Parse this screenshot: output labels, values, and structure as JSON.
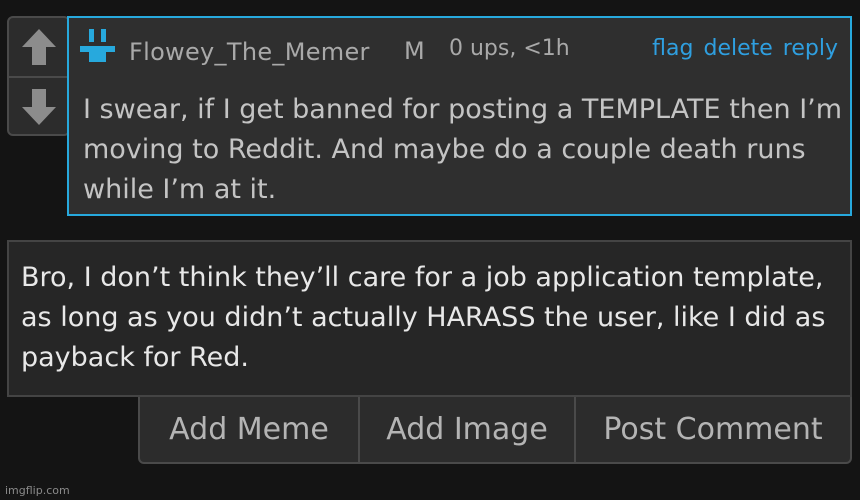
{
  "comment": {
    "username": "Flowey_The_Memer",
    "badge": "M",
    "meta": "0 ups, <1h",
    "actions": {
      "flag": "flag",
      "delete": "delete",
      "reply": "reply"
    },
    "body": "I swear, if I get banned for posting a TEMPLATE then I’m moving to Reddit. And maybe do a couple death runs while I’m at it."
  },
  "reply_box": {
    "text": "Bro, I don’t think they’ll care for a job application template, as long as you didn’t actually HARASS the user, like I did as payback for Red."
  },
  "buttons": {
    "add_meme": "Add Meme",
    "add_image": "Add Image",
    "post_comment": "Post Comment"
  },
  "watermark": "imgflip.com",
  "colors": {
    "accent": "#27a9dd",
    "link": "#2f9fe0",
    "background": "#141414",
    "card": "#2f2f2f"
  },
  "icons": {
    "upvote": "arrow-up-icon",
    "downvote": "arrow-down-icon",
    "avatar": "avatar-icon"
  }
}
